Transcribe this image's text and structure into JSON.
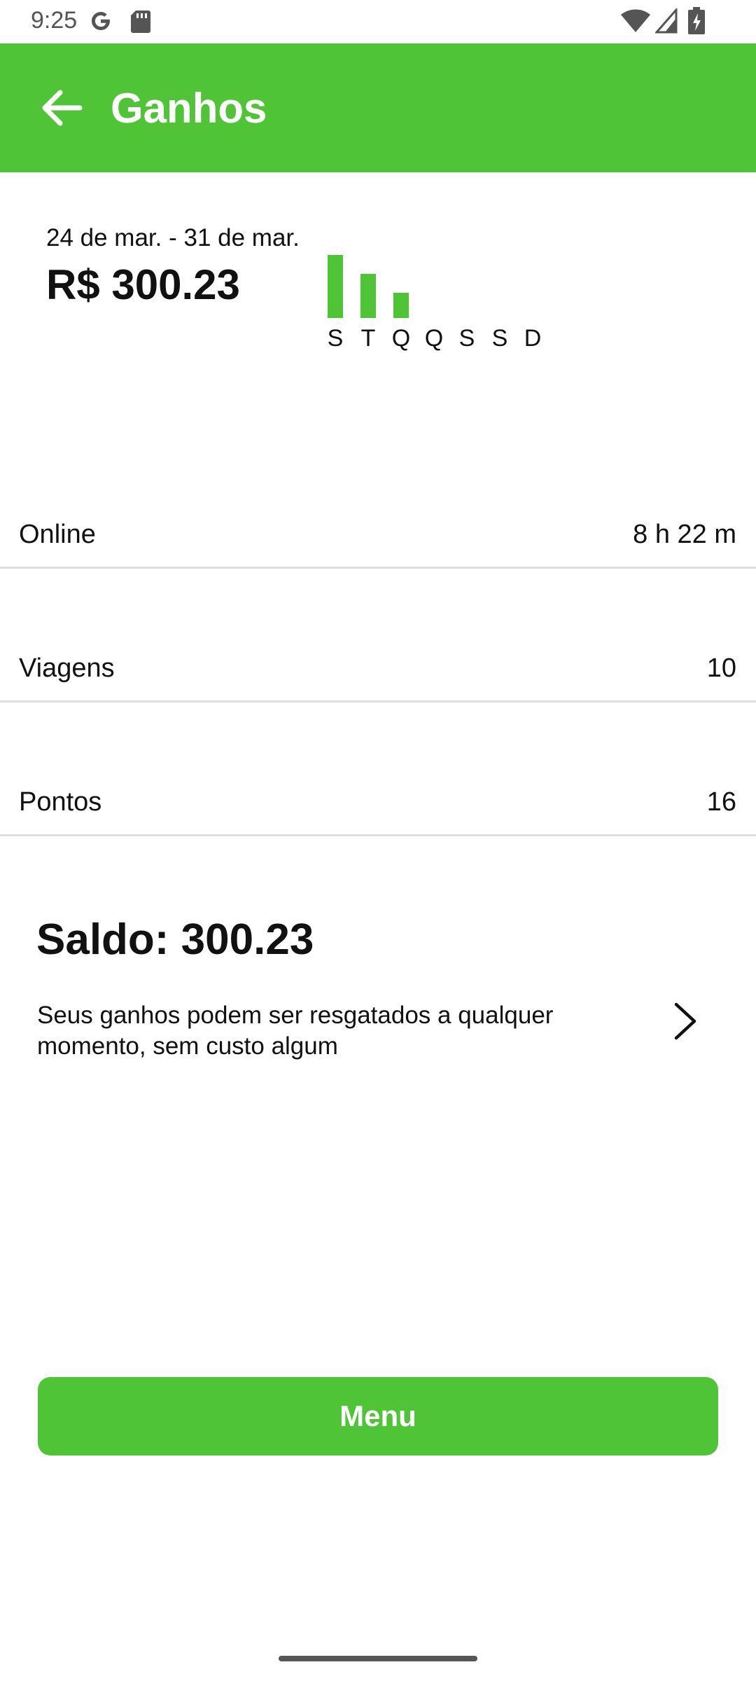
{
  "status_bar": {
    "time": "9:25",
    "icons": [
      "google-icon",
      "sd-card-icon",
      "wifi-icon",
      "cell-signal-icon",
      "battery-charging-icon"
    ]
  },
  "app_bar": {
    "title": "Ganhos",
    "back_icon": "arrow-left-icon",
    "color": "#50c437"
  },
  "summary": {
    "date_range": "24 de mar. - 31 de mar.",
    "total": "R$ 300.23"
  },
  "chart_data": {
    "type": "bar",
    "categories": [
      "S",
      "T",
      "Q",
      "Q",
      "S",
      "S",
      "D"
    ],
    "values": [
      1.0,
      0.7,
      0.4,
      0,
      0,
      0,
      0
    ],
    "color": "#50c437"
  },
  "stats": [
    {
      "label": "Online",
      "value": "8 h 22 m"
    },
    {
      "label": "Viagens",
      "value": "10"
    },
    {
      "label": "Pontos",
      "value": "16"
    }
  ],
  "balance": {
    "title": "Saldo: 300.23",
    "description": "Seus ganhos podem ser resgatados a qualquer momento, sem custo algum",
    "chevron_icon": "chevron-right-icon"
  },
  "menu_button": {
    "label": "Menu",
    "color": "#50c437"
  }
}
